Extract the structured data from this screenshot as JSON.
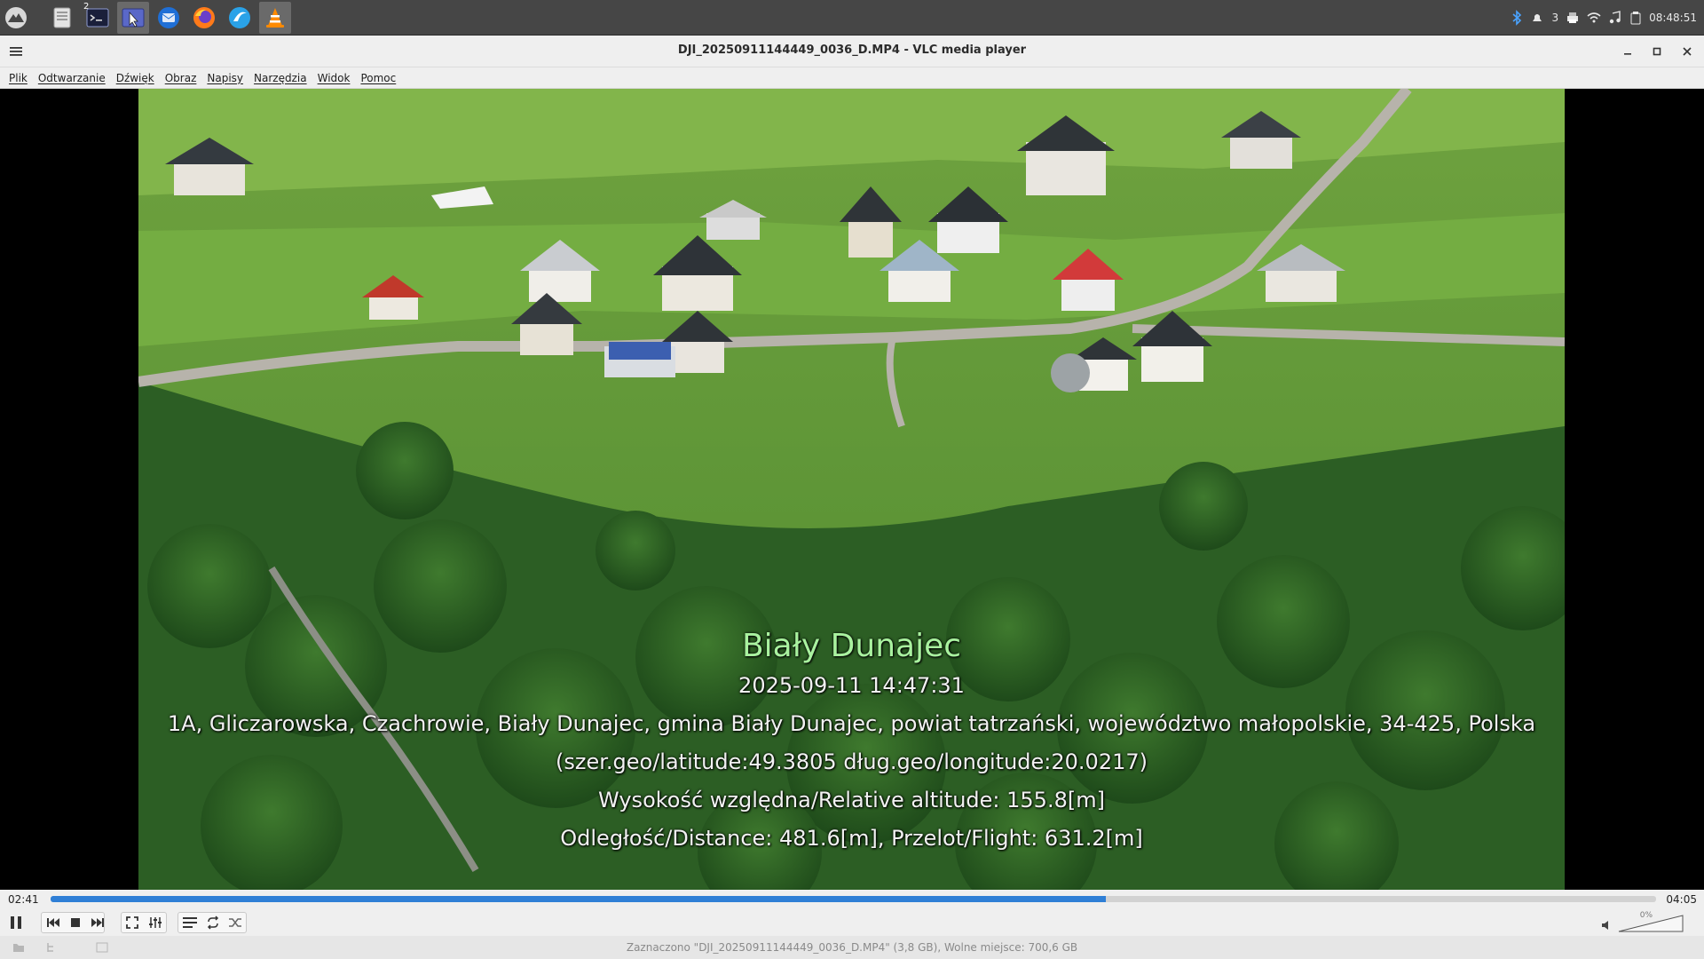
{
  "panel": {
    "launchers": [
      "app-menu",
      "file-manager",
      "terminal",
      "screenshot-tool",
      "thunderbird",
      "firefox",
      "web-browser",
      "vlc"
    ],
    "terminal_badge": "2",
    "tray": {
      "notify_count": "3",
      "clock": "08:48:51"
    }
  },
  "window": {
    "title": "DJI_20250911144449_0036_D.MP4 - VLC media player"
  },
  "menubar": [
    "Plik",
    "Odtwarzanie",
    "Dźwięk",
    "Obraz",
    "Napisy",
    "Narzędzia",
    "Widok",
    "Pomoc"
  ],
  "subtitles": {
    "place": "Biały Dunajec",
    "datetime": "2025-09-11 14:47:31",
    "address": "1A, Gliczarowska, Czachrowie, Biały Dunajec, gmina Biały Dunajec, powiat tatrzański, województwo małopolskie, 34-425, Polska",
    "coords": "(szer.geo/latitude:49.3805 dług.geo/longitude:20.0217)",
    "altitude": "Wysokość względna/Relative altitude: 155.8[m]",
    "distance": "Odległość/Distance: 481.6[m],  Przelot/Flight: 631.2[m]"
  },
  "player": {
    "elapsed": "02:41",
    "total": "04:05",
    "progress": 0.657,
    "volume_label": "0%",
    "volume_level": 0
  },
  "statusbar": {
    "text": "Zaznaczono \"DJI_20250911144449_0036_D.MP4\" (3,8 GB), Wolne miejsce: 700,6 GB"
  },
  "colors": {
    "accent": "#2f7fd6",
    "subtitle_place": "#a9f29f"
  }
}
